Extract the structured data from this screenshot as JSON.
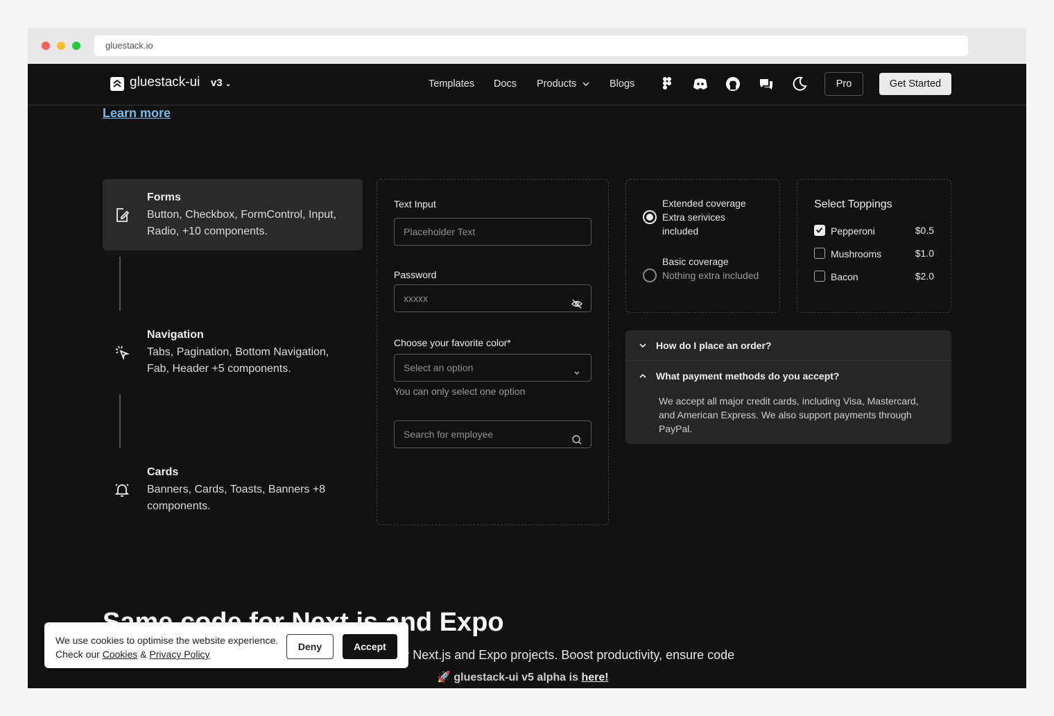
{
  "browser": {
    "url": "gluestack.io"
  },
  "nav": {
    "brand": "gluestack-ui",
    "version": "v3",
    "links": [
      "Templates",
      "Docs",
      "Products",
      "Blogs"
    ],
    "pro_label": "Pro",
    "get_started_label": "Get Started"
  },
  "learn_more": "Learn more",
  "features": [
    {
      "title": "Forms",
      "desc": "Button, Checkbox, FormControl, Input, Radio, +10 components."
    },
    {
      "title": "Navigation",
      "desc": "Tabs, Pagination, Bottom Navigation, Fab, Header +5 components."
    },
    {
      "title": "Cards",
      "desc": "Banners, Cards, Toasts, Banners +8 components."
    }
  ],
  "form": {
    "text_input_label": "Text Input",
    "text_input_placeholder": "Placeholder Text",
    "password_label": "Password",
    "password_value": "xxxxx",
    "color_label": "Choose your favorite color*",
    "color_placeholder": "Select an option",
    "color_hint": "You can only select one option",
    "search_placeholder": "Search for employee"
  },
  "radios": [
    {
      "title": "Extended coverage",
      "sub": "Extra serivices included",
      "selected": true
    },
    {
      "title": "Basic coverage",
      "sub": "Nothing extra included",
      "selected": false
    }
  ],
  "toppings": {
    "title": "Select Toppings",
    "items": [
      {
        "name": "Pepperoni",
        "price": "$0.5",
        "checked": true
      },
      {
        "name": "Mushrooms",
        "price": "$1.0",
        "checked": false
      },
      {
        "name": "Bacon",
        "price": "$2.0",
        "checked": false
      }
    ]
  },
  "accordion": [
    {
      "question": "How do I place an order?",
      "expanded": false
    },
    {
      "question": "What payment methods do you accept?",
      "expanded": true,
      "answer": "We accept all major credit cards, including Visa, Mastercard, and American Express. We also support payments through PayPal."
    }
  ],
  "hero": {
    "title": "Same code for Next.js and Expo",
    "subtitle": "Build for web and mobile with the same components for Next.js and Expo projects. Boost productivity, ensure code"
  },
  "banner": {
    "prefix": "🚀 gluestack-ui v5 alpha is ",
    "link": "here!"
  },
  "cookie": {
    "line1": "We use cookies to optimise the website experience.",
    "line2_prefix": "Check our ",
    "cookies_link": "Cookies",
    "amp": " & ",
    "privacy_link": "Privacy Policy",
    "deny_label": "Deny",
    "accept_label": "Accept"
  },
  "colors": {
    "background": "#111111",
    "accent_link": "#7ab8e8",
    "panel": "#262626"
  }
}
